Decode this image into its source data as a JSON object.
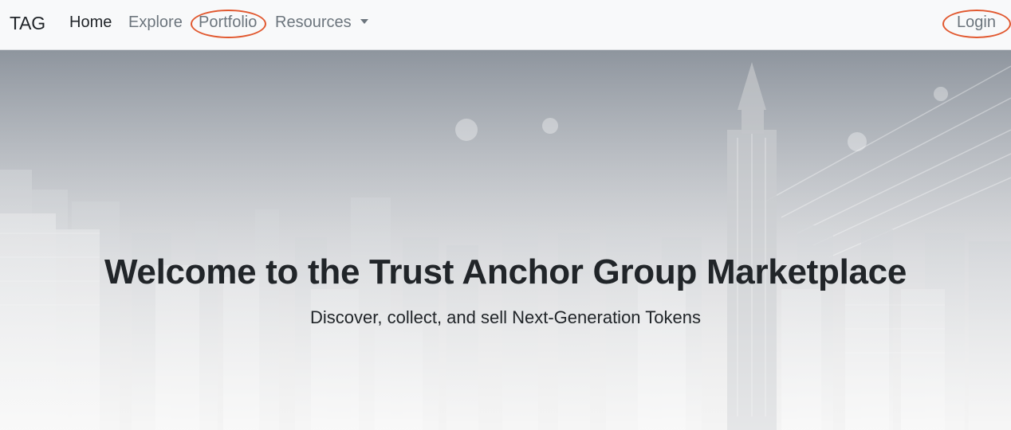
{
  "navbar": {
    "brand": "TAG",
    "links": [
      {
        "label": "Home"
      },
      {
        "label": "Explore"
      },
      {
        "label": "Portfolio"
      },
      {
        "label": "Resources"
      }
    ],
    "login_label": "Login",
    "annotation_color": "#e1582f"
  },
  "hero": {
    "title": "Welcome to the Trust Anchor Group Marketplace",
    "subtitle": "Discover, collect, and sell Next-Generation Tokens"
  }
}
